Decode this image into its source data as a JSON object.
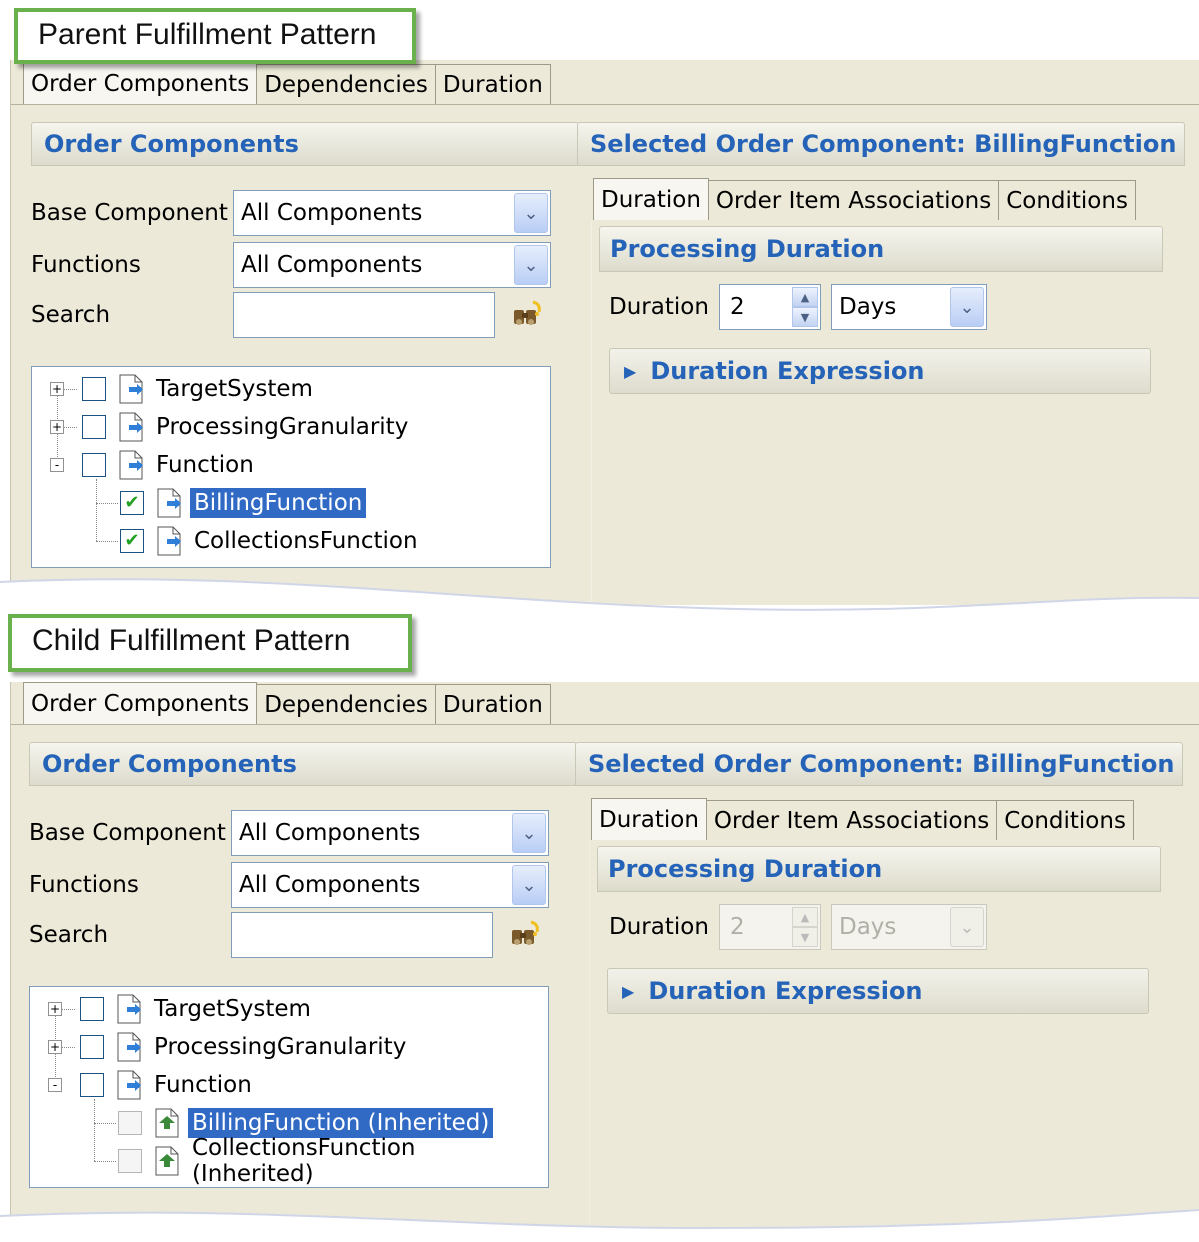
{
  "parent": {
    "label": "Parent Fulfillment Pattern",
    "tabs": [
      "Order Components",
      "Dependencies",
      "Duration"
    ],
    "left_header": "Order Components",
    "base_component_label": "Base Component",
    "base_component_value": "All Components",
    "functions_label": "Functions",
    "functions_value": "All Components",
    "search_label": "Search",
    "search_value": "",
    "tree": [
      {
        "label": "TargetSystem",
        "expander": "+",
        "checked": false,
        "level": 0
      },
      {
        "label": "ProcessingGranularity",
        "expander": "+",
        "checked": false,
        "level": 0
      },
      {
        "label": "Function",
        "expander": "-",
        "checked": false,
        "level": 0
      },
      {
        "label": "BillingFunction",
        "checked": true,
        "level": 1,
        "selected": true
      },
      {
        "label": "CollectionsFunction",
        "checked": true,
        "level": 1
      }
    ],
    "right_header": "Selected Order Component: BillingFunction",
    "right_tabs": [
      "Duration",
      "Order Item Associations",
      "Conditions"
    ],
    "processing_header": "Processing Duration",
    "duration_label": "Duration",
    "duration_value": "2",
    "duration_unit": "Days",
    "expression_label": "Duration Expression"
  },
  "child": {
    "label": "Child Fulfillment Pattern",
    "tabs": [
      "Order Components",
      "Dependencies",
      "Duration"
    ],
    "left_header": "Order Components",
    "base_component_label": "Base Component",
    "base_component_value": "All Components",
    "functions_label": "Functions",
    "functions_value": "All Components",
    "search_label": "Search",
    "search_value": "",
    "tree": [
      {
        "label": "TargetSystem",
        "expander": "+",
        "checked": false,
        "level": 0
      },
      {
        "label": "ProcessingGranularity",
        "expander": "+",
        "checked": false,
        "level": 0
      },
      {
        "label": "Function",
        "expander": "-",
        "checked": false,
        "level": 0
      },
      {
        "label": "BillingFunction (Inherited)",
        "checked": false,
        "level": 1,
        "selected": true
      },
      {
        "label": "CollectionsFunction (Inherited)",
        "checked": false,
        "level": 1
      }
    ],
    "right_header": "Selected Order Component: BillingFunction",
    "right_tabs": [
      "Duration",
      "Order Item Associations",
      "Conditions"
    ],
    "processing_header": "Processing Duration",
    "duration_label": "Duration",
    "duration_value": "2",
    "duration_unit": "Days",
    "expression_label": "Duration Expression"
  }
}
